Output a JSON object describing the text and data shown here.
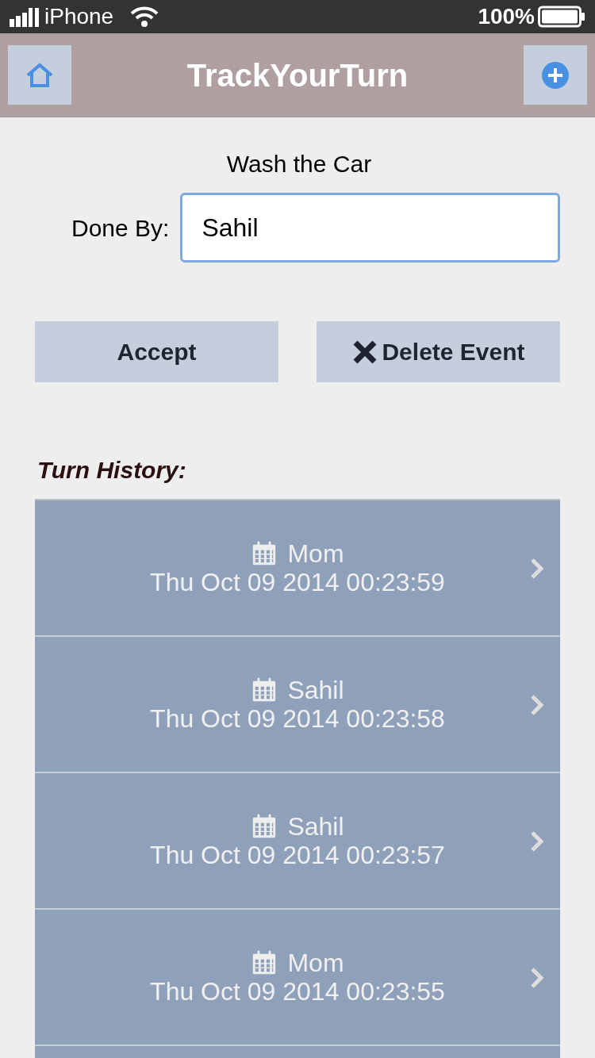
{
  "status_bar": {
    "carrier": "iPhone",
    "battery": "100%"
  },
  "header": {
    "title": "TrackYourTurn"
  },
  "task": {
    "title": "Wash the Car"
  },
  "done_by": {
    "label": "Done By:",
    "value": "Sahil"
  },
  "buttons": [
    {
      "kind": "accept",
      "label": "Accept"
    },
    {
      "kind": "delete",
      "label": "Delete Event"
    }
  ],
  "history": {
    "title": "Turn History:",
    "items": [
      {
        "name": "Mom",
        "date": "Thu Oct 09 2014 00:23:59"
      },
      {
        "name": "Sahil",
        "date": "Thu Oct 09 2014 00:23:58"
      },
      {
        "name": "Sahil",
        "date": "Thu Oct 09 2014 00:23:57"
      },
      {
        "name": "Mom",
        "date": "Thu Oct 09 2014 00:23:55"
      }
    ]
  }
}
